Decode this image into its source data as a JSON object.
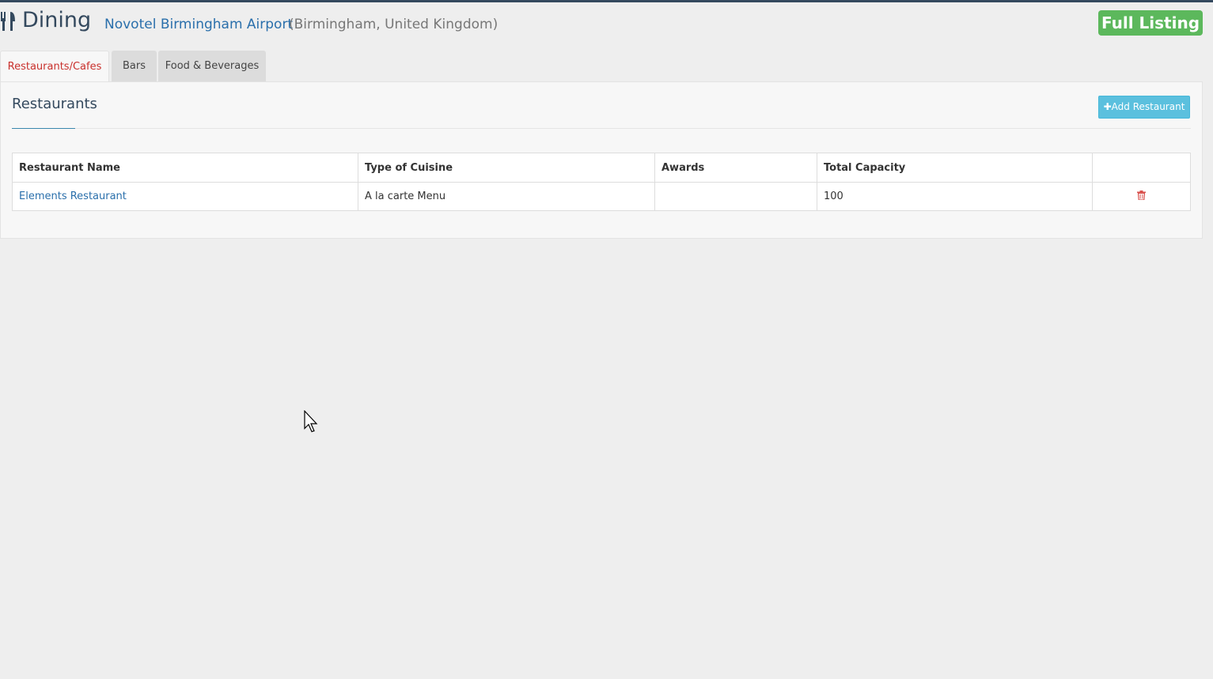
{
  "header": {
    "icon": "cutlery-icon",
    "title": "Dining",
    "hotel_name": "Novotel Birmingham Airport",
    "hotel_location": "(Birmingham, United Kingdom)",
    "full_listing_label": "Full Listing"
  },
  "tabs": [
    {
      "label": "Restaurants/Cafes",
      "active": true
    },
    {
      "label": "Bars",
      "active": false
    },
    {
      "label": "Food & Beverages",
      "active": false
    }
  ],
  "panel": {
    "title": "Restaurants",
    "add_button_label": "Add Restaurant",
    "add_button_icon": "plus-icon"
  },
  "table": {
    "headers": [
      "Restaurant Name",
      "Type of Cuisine",
      "Awards",
      "Total Capacity",
      ""
    ],
    "rows": [
      {
        "name": "Elements Restaurant",
        "cuisine": "A la carte Menu",
        "awards": "",
        "capacity": "100",
        "action_icon": "trash-icon"
      }
    ]
  },
  "colors": {
    "accent_link": "#2a6fab",
    "full_listing_bg": "#5cb85c",
    "add_button_bg": "#5bc0de",
    "active_tab_text": "#c9302c",
    "delete_icon": "#d9534f"
  }
}
